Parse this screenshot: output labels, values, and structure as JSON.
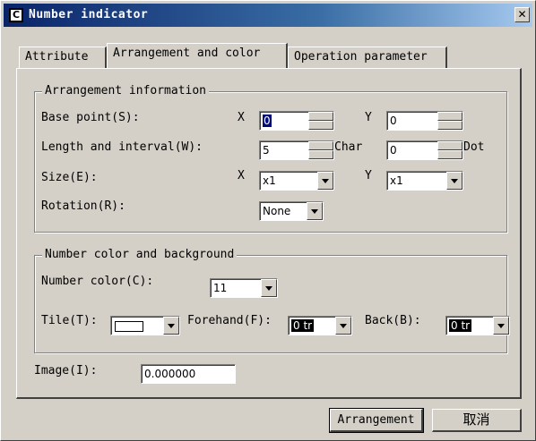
{
  "window": {
    "title": "Number indicator",
    "icon_letter": "C",
    "close_glyph": "✕"
  },
  "tabs": [
    {
      "label": "Attribute"
    },
    {
      "label": "Arrangement and color"
    },
    {
      "label": "Operation parameter"
    }
  ],
  "arrangement": {
    "group_title": "Arrangement information",
    "base_point": {
      "label": "Base point(S):",
      "x_label": "X",
      "x_value": "0",
      "y_label": "Y",
      "y_value": "0"
    },
    "length": {
      "label": "Length and interval(W):",
      "value": "5",
      "unit": "Char",
      "interval_value": "0",
      "interval_unit": "Dot"
    },
    "size": {
      "label": "Size(E):",
      "x_label": "X",
      "x_value": "x1",
      "y_label": "Y",
      "y_value": "x1"
    },
    "rotation": {
      "label": "Rotation(R):",
      "value": "None"
    }
  },
  "color": {
    "group_title": "Number color and background",
    "number_color": {
      "label": "Number color(C):",
      "value": "11"
    },
    "tile": {
      "label": "Tile(T):"
    },
    "forehand": {
      "label": "Forehand(F):",
      "value": "0 tr"
    },
    "back": {
      "label": "Back(B):",
      "value": "0 tr"
    }
  },
  "image": {
    "label": "Image(I):",
    "value": "0.000000"
  },
  "buttons": {
    "arrangement": "Arrangement",
    "cancel": "取消"
  }
}
